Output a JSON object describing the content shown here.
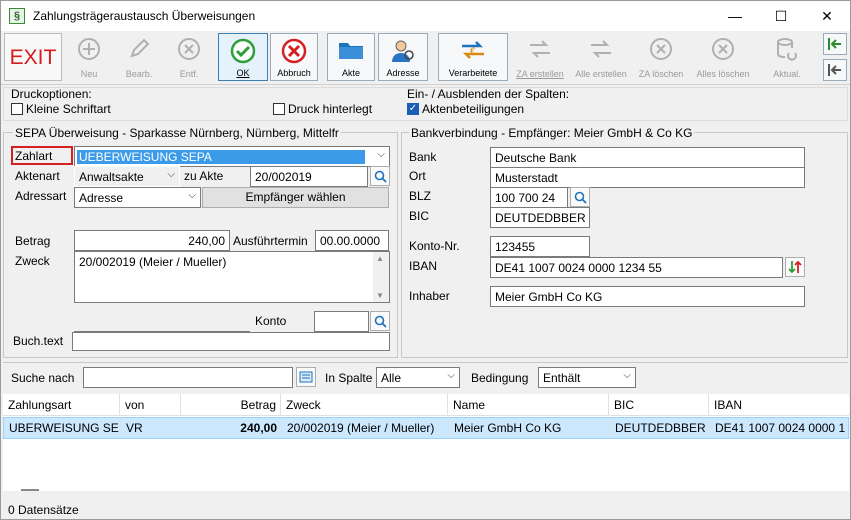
{
  "window": {
    "title": "Zahlungsträgeraustausch Überweisungen",
    "minimize": "—",
    "maximize": "☐",
    "close": "✕"
  },
  "toolbar": {
    "exit": "EXIT",
    "neu": "Neu",
    "bearb": "Bearb.",
    "entf": "Entf.",
    "ok": "OK",
    "abbruch": "Abbruch",
    "akte": "Akte",
    "adresse": "Adresse",
    "verarbeitete": "Verarbeitete",
    "za_erstellen": "ZA erstellen",
    "alle_erstellen": "Alle erstellen",
    "za_loeschen": "ZA löschen",
    "alles_loeschen": "Alles löschen",
    "aktual": "Aktual."
  },
  "druckoptionen": {
    "title": "Druckoptionen:",
    "kleine_schrift": "Kleine Schriftart",
    "kleine_schrift_checked": false,
    "druck_hinterlegt": "Druck hinterlegt",
    "druck_hinterlegt_checked": false
  },
  "spalten": {
    "title": "Ein- / Ausblenden der Spalten:",
    "aktenbeteiligungen": "Aktenbeteiligungen",
    "aktenbeteiligungen_checked": true
  },
  "sepa": {
    "title": "SEPA Überweisung - Sparkasse Nürnberg, Nürnberg, Mittelfr",
    "zahlart_label": "Zahlart",
    "zahlart_value": "UEBERWEISUNG SEPA",
    "aktenart_label": "Aktenart",
    "aktenart_value": "Anwaltsakte",
    "zu_akte_label": "zu Akte",
    "zu_akte_value": "20/002019",
    "adressart_label": "Adressart",
    "adressart_value": "Adresse",
    "empfaenger_button": "Empfänger wählen",
    "betrag_label": "Betrag",
    "betrag_value": "240,00",
    "ausfuehrtermin_label": "Ausführtermin",
    "ausfuehrtermin_value": "00.00.0000",
    "zweck_label": "Zweck",
    "zweck_value": "20/002019 (Meier / Mueller)",
    "konto_label": "Konto",
    "konto_value": "",
    "buchtext_label": "Buch.text",
    "buchtext_value": ""
  },
  "bank": {
    "title": "Bankverbindung - Empfänger: Meier GmbH & Co KG",
    "bank_label": "Bank",
    "bank_value": "Deutsche Bank",
    "ort_label": "Ort",
    "ort_value": "Musterstadt",
    "blz_label": "BLZ",
    "blz_value": "100 700 24",
    "bic_label": "BIC",
    "bic_value": "DEUTDEDBBER",
    "konto_nr_label": "Konto-Nr.",
    "konto_nr_value": "123455",
    "iban_label": "IBAN",
    "iban_value": "DE41 1007 0024 0000 1234 55",
    "inhaber_label": "Inhaber",
    "inhaber_value": "Meier GmbH  Co KG"
  },
  "search": {
    "suche_nach_label": "Suche nach",
    "suche_nach_value": "",
    "in_spalte_label": "In Spalte",
    "in_spalte_value": "Alle",
    "bedingung_label": "Bedingung",
    "bedingung_value": "Enthält"
  },
  "table": {
    "columns": [
      "Zahlungsart",
      "von",
      "Betrag",
      "Zweck",
      "Name",
      "BIC",
      "IBAN"
    ],
    "rows": [
      [
        "UBERWEISUNG SE",
        "VR",
        "240,00",
        "20/002019 (Meier / Mueller)",
        "Meier GmbH  Co KG",
        "DEUTDEDBBER",
        "DE41 1007 0024 0000 1"
      ]
    ]
  },
  "status": {
    "text": "0 Datensätze"
  },
  "colors": {
    "exit_red": "#d41c1c",
    "selection_blue": "#cce8ff",
    "highlight_blue": "#3c9be8",
    "ok_green": "#2e9e3a",
    "abbruch_red": "#d42020"
  }
}
